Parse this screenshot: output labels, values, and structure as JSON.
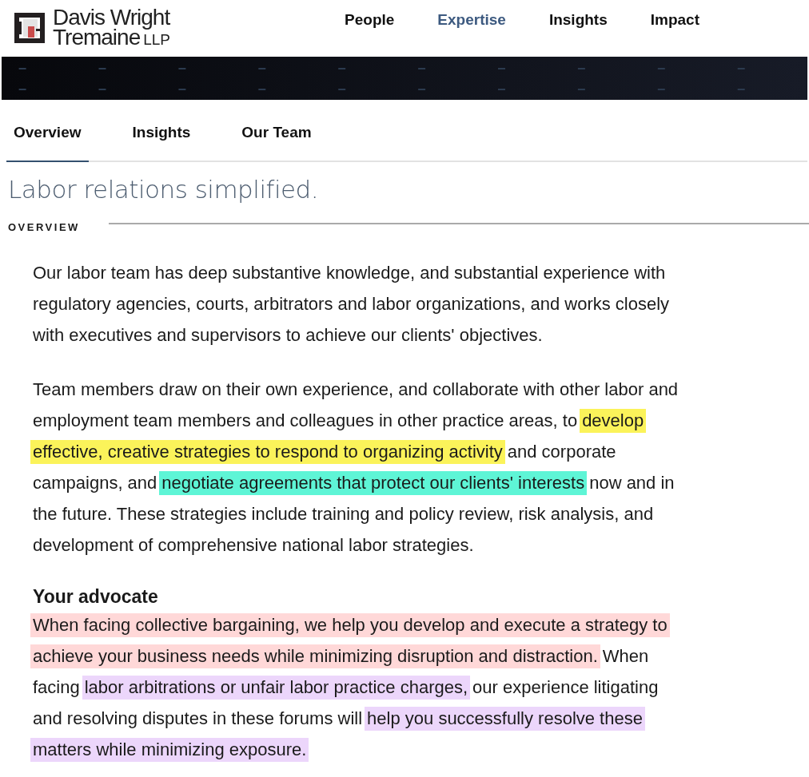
{
  "logo": {
    "line_1": "Davis Wright",
    "line_2": "Tremaine",
    "suffix": "LLP"
  },
  "nav": [
    {
      "label": "People",
      "selected": false
    },
    {
      "label": "Expertise",
      "selected": true
    },
    {
      "label": "Insights",
      "selected": false
    },
    {
      "label": "Impact",
      "selected": false
    }
  ],
  "tabs": [
    {
      "label": "Overview",
      "selected": true
    },
    {
      "label": "Insights",
      "selected": false
    },
    {
      "label": "Our Team",
      "selected": false
    }
  ],
  "heading": "Labor relations simplified.",
  "section_label": "OVERVIEW",
  "paragraphs": [
    {
      "lines": [
        [
          {
            "text": "Our labor team has deep substantive knowledge, and substantial experience with"
          }
        ],
        [
          {
            "text": "regulatory agencies, courts, arbitrators and labor organizations, and works closely"
          }
        ],
        [
          {
            "text": "with executives and supervisors to achieve our clients' objectives."
          }
        ]
      ]
    },
    {
      "lines": [
        [
          {
            "text": "Team members draw on their own experience, and collaborate with other labor and"
          }
        ],
        [
          {
            "text": "employment team members and colleagues in other practice areas, to"
          },
          {
            "text": "develop",
            "color": "#fbf35a"
          }
        ],
        [
          {
            "text": "effective, creative strategies to respond to organizing activity",
            "color": "#fbf35a"
          },
          {
            "text": "and corporate"
          }
        ],
        [
          {
            "text": "campaigns, and"
          },
          {
            "text": "negotiate agreements that protect our clients' interests",
            "color": "#5ef5d6"
          },
          {
            "text": "now and in"
          }
        ],
        [
          {
            "text": "the future. These strategies include training and policy review, risk analysis, and"
          }
        ],
        [
          {
            "text": "development of comprehensive national labor strategies."
          }
        ]
      ]
    }
  ],
  "subheading": "Your advocate",
  "advocate_paragraph": {
    "lines": [
      [
        {
          "text": "When facing collective bargaining, we help you develop and execute a strategy to",
          "color": "#ffd8d8"
        }
      ],
      [
        {
          "text": "achieve your business needs while minimizing disruption and distraction.",
          "color": "#ffd8d8"
        },
        {
          "text": "When"
        }
      ],
      [
        {
          "text": "facing"
        },
        {
          "text": "labor arbitrations or unfair labor practice charges,",
          "color": "#ecd6fb"
        },
        {
          "text": "our experience litigating"
        }
      ],
      [
        {
          "text": "and resolving disputes in these forums will"
        },
        {
          "text": "help you successfully resolve these",
          "color": "#ecd6fb"
        }
      ],
      [
        {
          "text": "matters while minimizing exposure.",
          "color": "#ecd6fb"
        }
      ]
    ]
  }
}
